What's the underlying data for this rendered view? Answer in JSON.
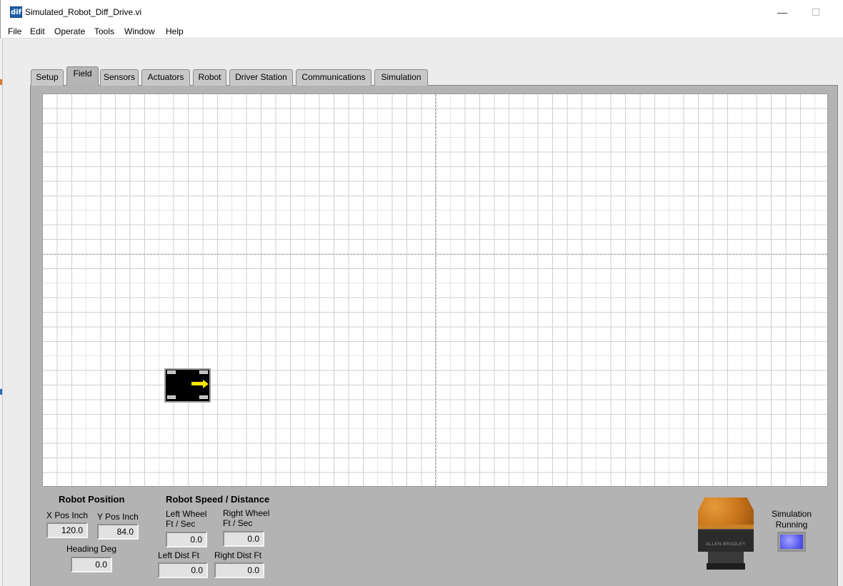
{
  "window": {
    "title": "Simulated_Robot_Diff_Drive.vi",
    "icon_text": "dif",
    "minimize_glyph": "—"
  },
  "menu": [
    "File",
    "Edit",
    "Operate",
    "Tools",
    "Window",
    "Help"
  ],
  "tabs": [
    {
      "label": "Setup",
      "active": false
    },
    {
      "label": "Field",
      "active": true
    },
    {
      "label": "Sensors",
      "active": false
    },
    {
      "label": "Actuators",
      "active": false
    },
    {
      "label": "Robot",
      "active": false
    },
    {
      "label": "Driver Station",
      "active": false
    },
    {
      "label": "Communications",
      "active": false
    },
    {
      "label": "Simulation",
      "active": false
    }
  ],
  "robot_position": {
    "title": "Robot Position",
    "x_label": "X Pos Inch",
    "x_value": "120.0",
    "y_label": "Y Pos Inch",
    "y_value": "84.0",
    "heading_label": "Heading Deg",
    "heading_value": "0.0"
  },
  "robot_speed": {
    "title": "Robot Speed / Distance",
    "left_wheel_label": "Left Wheel\nFt / Sec",
    "left_wheel_value": "0.0",
    "right_wheel_label": "Right Wheel\nFt / Sec",
    "right_wheel_value": "0.0",
    "left_dist_label": "Left Dist Ft",
    "left_dist_value": "0.0",
    "right_dist_label": "Right Dist Ft",
    "right_dist_value": "0.0"
  },
  "light_tower": {
    "brand_text": "ALLEN-BRADLEY"
  },
  "simulation_indicator": {
    "label": "Simulation Running",
    "on": true,
    "color": "#6060f0"
  },
  "colors": {
    "panel": "#b3b3b3",
    "robot_arrow": "#f5e400"
  }
}
